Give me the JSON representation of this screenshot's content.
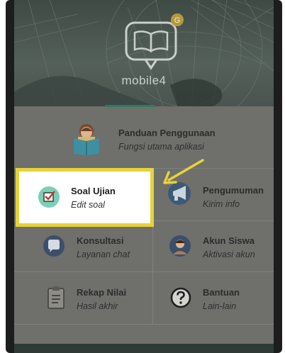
{
  "app": {
    "name": "mobile4",
    "logo_badge": "G"
  },
  "menu": {
    "panduan": {
      "title": "Panduan Penggunaan",
      "subtitle": "Fungsi utama aplikasi",
      "icon": "reading-person-icon"
    },
    "soal": {
      "title": "Soal Ujian",
      "subtitle": "Edit soal",
      "icon": "checkbox-icon"
    },
    "pengumuman": {
      "title": "Pengumuman",
      "subtitle": "Kirim info",
      "icon": "megaphone-icon"
    },
    "konsultasi": {
      "title": "Konsultasi",
      "subtitle": "Layanan chat",
      "icon": "chat-bubble-icon"
    },
    "akun": {
      "title": "Akun Siswa",
      "subtitle": "Aktivasi akun",
      "icon": "student-avatar-icon"
    },
    "rekap": {
      "title": "Rekap Nilai",
      "subtitle": "Hasil akhir",
      "icon": "clipboard-icon"
    },
    "bantuan": {
      "title": "Bantuan",
      "subtitle": "Lain-lain",
      "icon": "question-icon"
    }
  },
  "colors": {
    "highlight_border": "#e6d338",
    "arrow": "#e6d338",
    "accent_green": "#2f7a66",
    "menu_background": "#6f6f6c"
  }
}
